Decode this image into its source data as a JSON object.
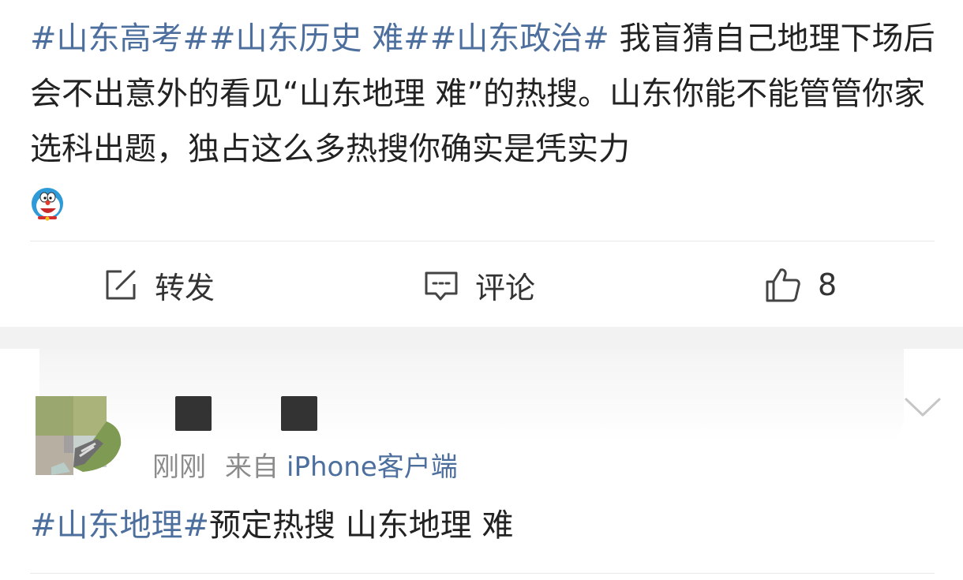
{
  "post1": {
    "tag1": "#山东高考#",
    "tag2": "#山东历史 难#",
    "tag3": "#山东政治#",
    "text": " 我盲猜自己地理下场后会不出意外的看见“山东地理 难”的热搜。山东你能不能管管你家选科出题，独占这么多热搜你确实是凭实力",
    "emoji": "doraemon-emoji"
  },
  "actions": {
    "repost_label": "转发",
    "comment_label": "评论",
    "like_count": "8"
  },
  "post2": {
    "time": "刚刚",
    "from_label": "来自",
    "source": "iPhone客户端",
    "tag": "#山东地理#",
    "text": "预定热搜 山东地理 难"
  },
  "colors": {
    "link": "#4d6f9e",
    "text": "#222222",
    "meta": "#8c8c8c",
    "gap": "#f2f2f2"
  },
  "icons": {
    "repost": "edit-square-icon",
    "comment": "comment-bubble-icon",
    "like": "thumbs-up-icon",
    "more": "chevron-down-icon"
  }
}
